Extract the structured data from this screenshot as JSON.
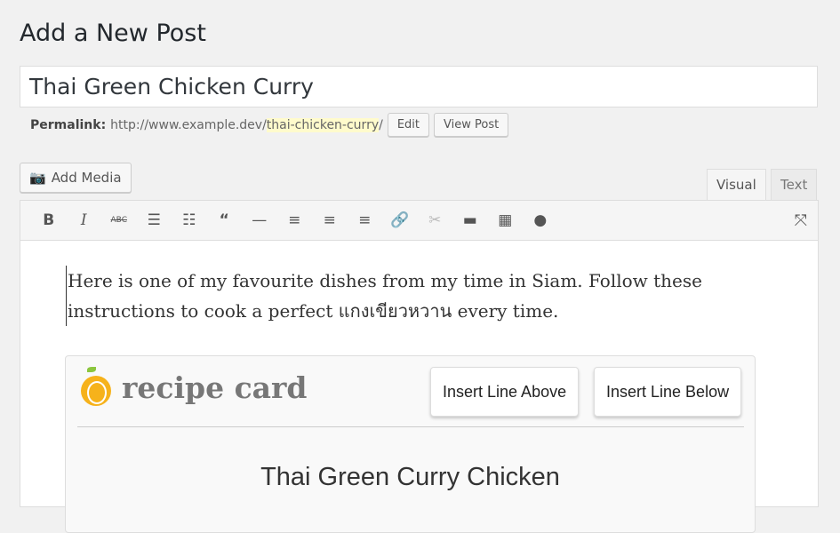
{
  "page_title": "Add a New Post",
  "post_title": "Thai Green Chicken Curry",
  "permalink": {
    "label": "Permalink:",
    "base": "http://www.example.dev/",
    "slug": "thai-chicken-curry",
    "trail": "/",
    "edit": "Edit",
    "view": "View Post"
  },
  "add_media": "Add Media",
  "tabs": {
    "visual": "Visual",
    "text": "Text"
  },
  "toolbar": [
    "bold",
    "italic",
    "strikethrough",
    "bulleted-list",
    "numbered-list",
    "blockquote",
    "horizontal-line",
    "align-left",
    "align-center",
    "align-right",
    "link",
    "unlink",
    "read-more",
    "toolbar-toggle",
    "recipe-card"
  ],
  "content": "Here is one of my favourite dishes from my time in Siam. Follow these instructions to cook a perfect แกงเขียวหวาน every time.",
  "recipe_card": {
    "logo": "recipe card",
    "insert_above": "Insert Line Above",
    "insert_below": "Insert Line Below",
    "title": "Thai Green Curry Chicken"
  }
}
